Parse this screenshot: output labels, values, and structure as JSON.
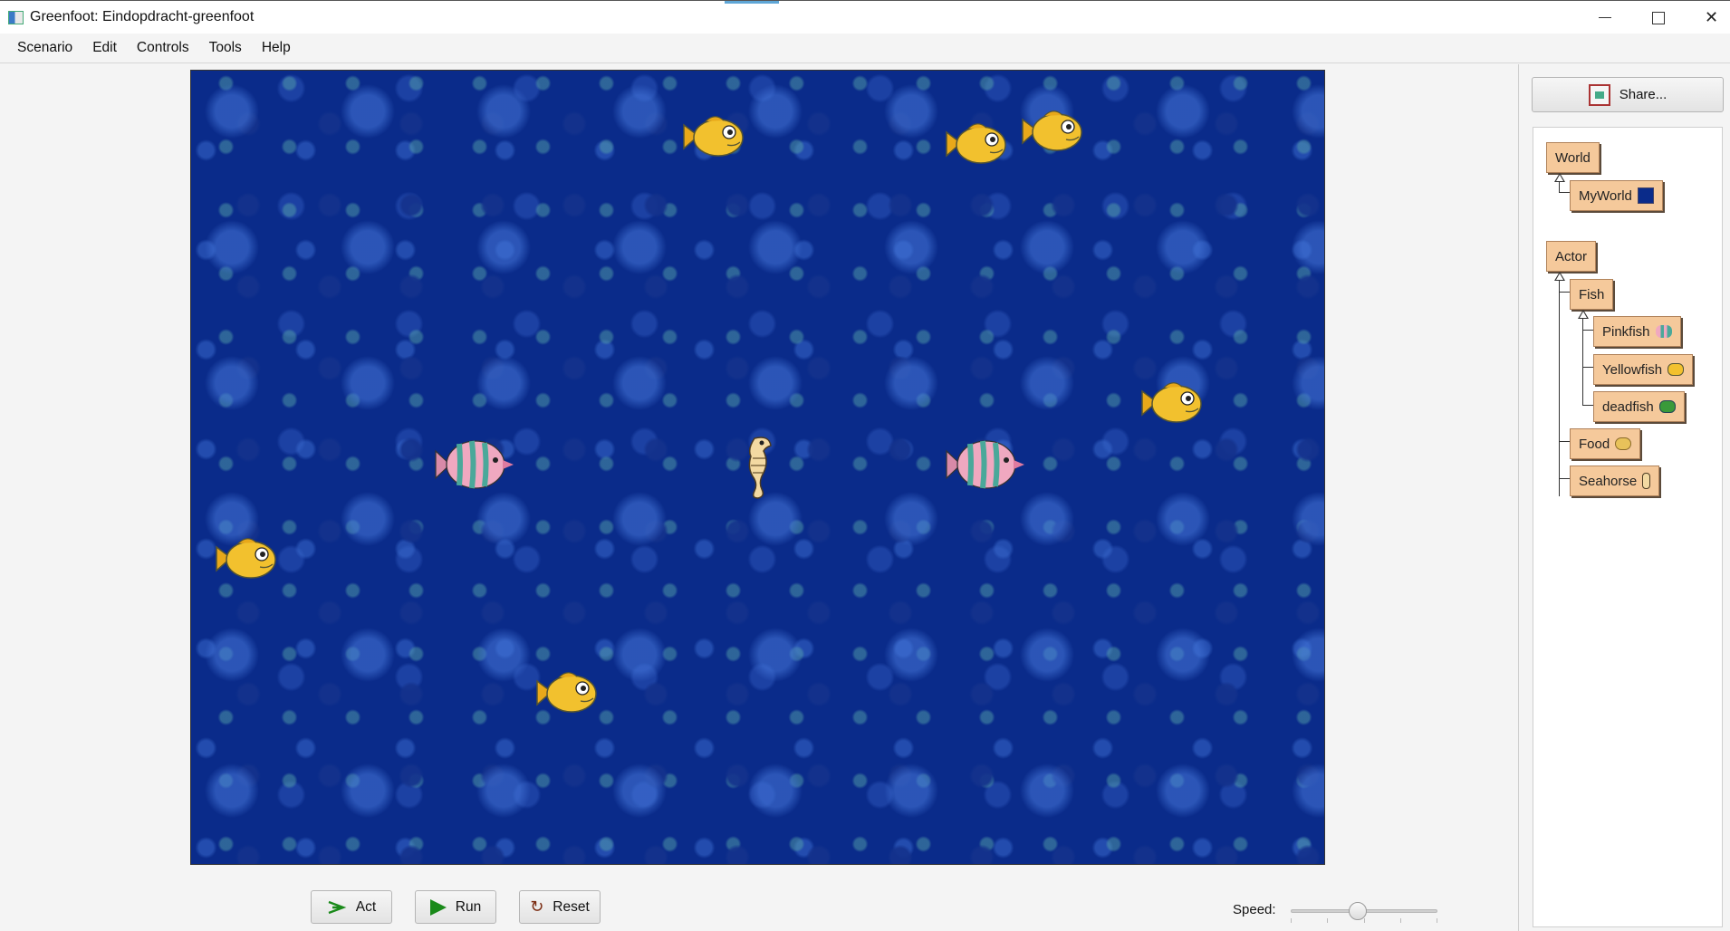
{
  "window": {
    "title": "Greenfoot: Eindopdracht-greenfoot",
    "minimize_icon": "minimize-icon",
    "maximize_icon": "maximize-icon",
    "close_label": "✕"
  },
  "menu": {
    "items": [
      "Scenario",
      "Edit",
      "Controls",
      "Tools",
      "Help"
    ]
  },
  "world": {
    "background": "ocean-bubbles",
    "actors": [
      {
        "type": "Yellowfish"
      },
      {
        "type": "Yellowfish"
      },
      {
        "type": "Yellowfish"
      },
      {
        "type": "Yellowfish"
      },
      {
        "type": "Yellowfish"
      },
      {
        "type": "Yellowfish"
      },
      {
        "type": "Pinkfish"
      },
      {
        "type": "Pinkfish"
      },
      {
        "type": "Seahorse"
      }
    ]
  },
  "controls": {
    "act_label": "Act",
    "run_label": "Run",
    "reset_label": "Reset",
    "speed_label": "Speed:",
    "speed_value": 0.45
  },
  "share": {
    "label": "Share..."
  },
  "class_tree": {
    "world_root": "World",
    "world_sub": "MyWorld",
    "actor_root": "Actor",
    "fish": "Fish",
    "pinkfish": "Pinkfish",
    "yellowfish": "Yellowfish",
    "deadfish": "deadfish",
    "food": "Food",
    "seahorse": "Seahorse"
  },
  "colors": {
    "class_box": "#f5c99b",
    "world_bg": "#0a2b8a",
    "run_icon": "#1a8a1a"
  }
}
